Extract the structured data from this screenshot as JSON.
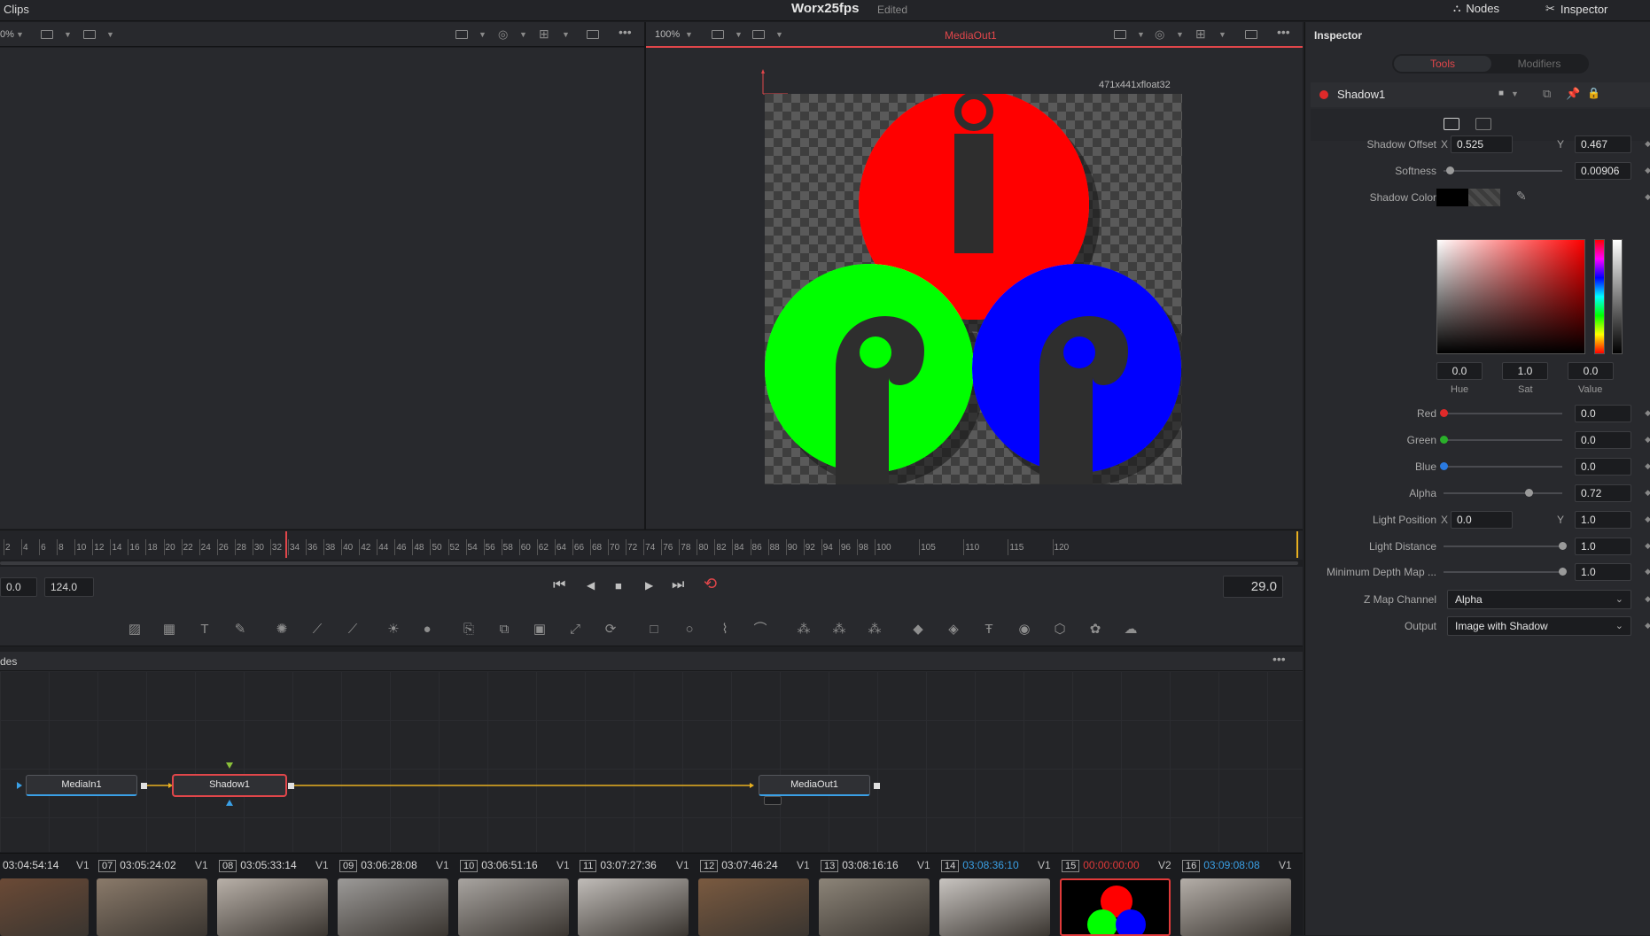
{
  "topbar": {
    "clips_label": "Clips",
    "project_title": "Worx25fps",
    "edited_label": "Edited",
    "nodes_label": "Nodes",
    "inspector_label": "Inspector"
  },
  "left_viewer": {
    "zoom": "0%"
  },
  "right_viewer": {
    "zoom": "100%",
    "title": "MediaOut1",
    "resolution": "471x441xfloat32"
  },
  "ruler": {
    "ticks": [
      "2",
      "4",
      "6",
      "8",
      "10",
      "12",
      "14",
      "16",
      "18",
      "20",
      "22",
      "24",
      "26",
      "28",
      "30",
      "32",
      "34",
      "36",
      "38",
      "40",
      "42",
      "44",
      "46",
      "48",
      "50",
      "52",
      "54",
      "56",
      "58",
      "60",
      "62",
      "64",
      "66",
      "68",
      "70",
      "72",
      "74",
      "76",
      "78",
      "80",
      "82",
      "84",
      "86",
      "88",
      "90",
      "92",
      "94",
      "96",
      "98",
      "100",
      "105",
      "110",
      "115",
      "120"
    ]
  },
  "transport": {
    "start_frame": "0.0",
    "end_frame": "124.0",
    "current_frame": "29.0"
  },
  "nodes_panel": {
    "header": "des",
    "nodes": [
      "MediaIn1",
      "Shadow1",
      "MediaOut1"
    ]
  },
  "clips": [
    {
      "num": "",
      "timecode": "03:04:54:14",
      "track": "V1",
      "color": "#d8d8d8"
    },
    {
      "num": "07",
      "timecode": "03:05:24:02",
      "track": "V1",
      "color": "#d8d8d8"
    },
    {
      "num": "08",
      "timecode": "03:05:33:14",
      "track": "V1",
      "color": "#d8d8d8"
    },
    {
      "num": "09",
      "timecode": "03:06:28:08",
      "track": "V1",
      "color": "#d8d8d8"
    },
    {
      "num": "10",
      "timecode": "03:06:51:16",
      "track": "V1",
      "color": "#d8d8d8"
    },
    {
      "num": "11",
      "timecode": "03:07:27:36",
      "track": "V1",
      "color": "#d8d8d8"
    },
    {
      "num": "12",
      "timecode": "03:07:46:24",
      "track": "V1",
      "color": "#d8d8d8"
    },
    {
      "num": "13",
      "timecode": "03:08:16:16",
      "track": "V1",
      "color": "#d8d8d8"
    },
    {
      "num": "14",
      "timecode": "03:08:36:10",
      "track": "V1",
      "color": "#3aa0e6"
    },
    {
      "num": "15",
      "timecode": "00:00:00:00",
      "track": "V2",
      "color": "#e03a3a"
    },
    {
      "num": "16",
      "timecode": "03:09:08:08",
      "track": "V1",
      "color": "#3aa0e6"
    }
  ],
  "inspector": {
    "header": "Inspector",
    "tabs": [
      "Tools",
      "Modifiers"
    ],
    "tool_name": "Shadow1",
    "shadow_offset_label": "Shadow Offset",
    "shadow_offset_x": "0.525",
    "shadow_offset_y": "0.467",
    "softness_label": "Softness",
    "softness": "0.00906",
    "softness_fraction": 0.05,
    "shadow_color_label": "Shadow Color",
    "hue": "0.0",
    "sat": "1.0",
    "value": "0.0",
    "hue_label": "Hue",
    "sat_label": "Sat",
    "value_label": "Value",
    "x_label": "X",
    "y_label": "Y",
    "red_label": "Red",
    "red": "0.0",
    "green_label": "Green",
    "green": "0.0",
    "blue_label": "Blue",
    "blue": "0.0",
    "alpha_label": "Alpha",
    "alpha": "0.72",
    "light_position_label": "Light Position",
    "light_x": "0.0",
    "light_y": "1.0",
    "light_distance_label": "Light Distance",
    "light_distance": "1.0",
    "min_depth_label": "Minimum Depth Map ...",
    "min_depth": "1.0",
    "z_map_label": "Z Map Channel",
    "z_map": "Alpha",
    "output_label": "Output",
    "output": "Image with Shadow"
  }
}
